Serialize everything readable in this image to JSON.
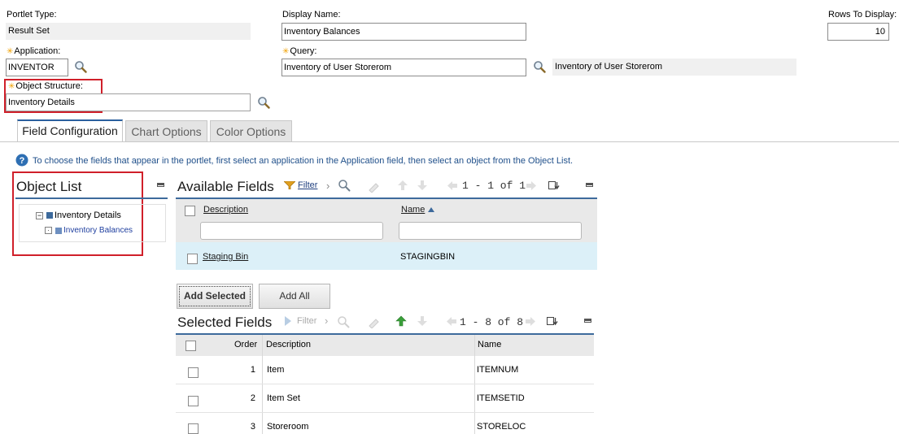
{
  "portlet_type": {
    "label": "Portlet Type:",
    "value": "Result Set"
  },
  "display_name": {
    "label": "Display Name:",
    "value": "Inventory Balances"
  },
  "rows_to_display": {
    "label": "Rows To Display:",
    "value": "10"
  },
  "application": {
    "required": "✳",
    "label": "Application:",
    "value": "INVENTOR"
  },
  "query": {
    "required": "✳",
    "label": "Query:",
    "value": "Inventory of User Storerom",
    "description": "Inventory of User Storerom"
  },
  "object_structure": {
    "required": "✳",
    "label": "Object Structure:",
    "value": "Inventory Details"
  },
  "tabs": [
    {
      "label": "Field Configuration"
    },
    {
      "label": "Chart Options"
    },
    {
      "label": "Color Options"
    }
  ],
  "help_text": "To choose the fields that appear in the portlet, first select an application in the Application field, then select an object from the Object List.",
  "object_list": {
    "title": "Object List",
    "tree": [
      {
        "label": "Inventory Details",
        "toggle": "−"
      },
      {
        "label": "Inventory Balances",
        "toggle": "·"
      }
    ]
  },
  "available_fields": {
    "title": "Available Fields",
    "filter_label": "Filter",
    "pagination": "1 - 1 of 1",
    "columns": {
      "description": "Description",
      "name": "Name"
    },
    "rows": [
      {
        "description": "Staging Bin",
        "name": "STAGINGBIN"
      }
    ]
  },
  "buttons": {
    "add_selected": "Add Selected",
    "add_all": "Add All"
  },
  "selected_fields": {
    "title": "Selected Fields",
    "filter_label": "Filter",
    "pagination": "1 - 8 of 8",
    "columns": {
      "order": "Order",
      "description": "Description",
      "name": "Name"
    },
    "rows": [
      {
        "order": "1",
        "description": "Item",
        "name": "ITEMNUM"
      },
      {
        "order": "2",
        "description": "Item Set",
        "name": "ITEMSETID"
      },
      {
        "order": "3",
        "description": "Storeroom",
        "name": "STORELOC"
      }
    ]
  },
  "colors": {
    "accent": "#3d6a9c",
    "highlight_box": "#d0202a",
    "selected_row": "#dcf0f8",
    "required_star": "#f0a000"
  }
}
